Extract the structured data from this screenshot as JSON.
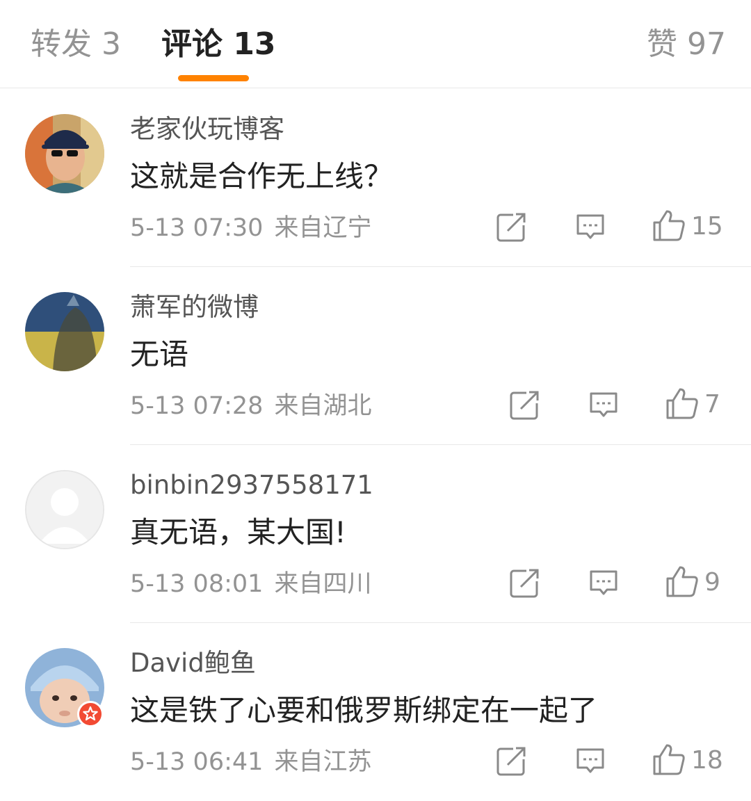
{
  "tabs": {
    "repost": "转发 3",
    "comments": "评论 13",
    "likes": "赞 97"
  },
  "accent_color": "#ff8200",
  "comments": [
    {
      "name": "老家伙玩博客",
      "content": "这就是合作无上线？",
      "time": "5-13 07:30",
      "region": "来自辽宁",
      "likes": "15",
      "avatar": "man-with-cap-avatar"
    },
    {
      "name": "萧军的微博",
      "content": "无语",
      "time": "5-13 07:28",
      "region": "来自湖北",
      "likes": "7",
      "avatar": "blue-yellow-portrait-avatar"
    },
    {
      "name": "binbin2937558171",
      "content": "真无语，某大国!",
      "time": "5-13 08:01",
      "region": "来自四川",
      "likes": "9",
      "avatar": "default-avatar"
    },
    {
      "name": "David鲍鱼",
      "content": "这是铁了心要和俄罗斯绑定在一起了",
      "time": "5-13 06:41",
      "region": "来自江苏",
      "likes": "18",
      "avatar": "baby-photo-avatar",
      "verified_badge": "star-badge-icon"
    }
  ],
  "icons": {
    "share": "share-icon",
    "reply": "comment-bubble-icon",
    "like": "thumbs-up-icon"
  }
}
